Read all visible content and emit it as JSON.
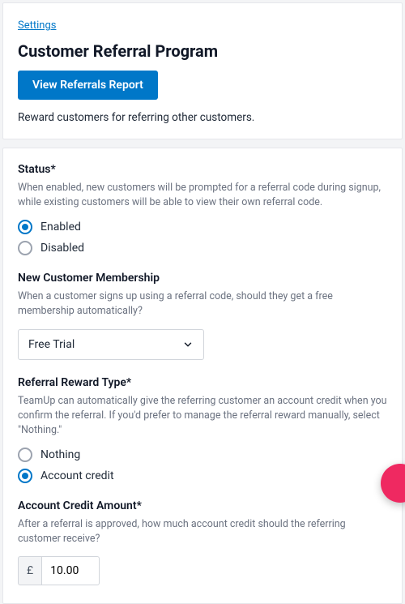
{
  "breadcrumb": {
    "label": "Settings"
  },
  "header": {
    "title": "Customer Referral Program",
    "report_button": "View Referrals Report",
    "description": "Reward customers for referring other customers."
  },
  "form": {
    "status": {
      "label": "Status*",
      "help": "When enabled, new customers will be prompted for a referral code during signup, while existing customers will be able to view their own referral code.",
      "options": {
        "enabled": "Enabled",
        "disabled": "Disabled"
      },
      "selected": "enabled"
    },
    "membership": {
      "label": "New Customer Membership",
      "help": "When a customer signs up using a referral code, should they get a free membership automatically?",
      "selected": "Free Trial"
    },
    "reward_type": {
      "label": "Referral Reward Type*",
      "help": "TeamUp can automatically give the referring customer an account credit when you confirm the referral. If you'd prefer to manage the referral reward manually, select \"Nothing.\"",
      "options": {
        "nothing": "Nothing",
        "credit": "Account credit"
      },
      "selected": "credit"
    },
    "credit_amount": {
      "label": "Account Credit Amount*",
      "help": "After a referral is approved, how much account credit should the referring customer receive?",
      "currency": "£",
      "value": "10.00"
    }
  }
}
